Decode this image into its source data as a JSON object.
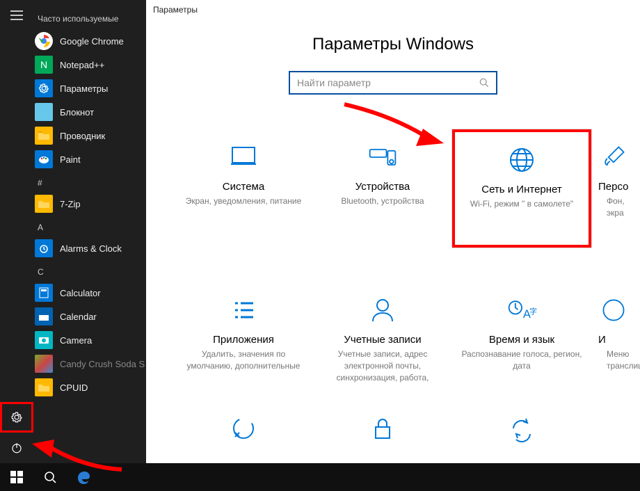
{
  "start_menu": {
    "most_used_header": "Часто используемые",
    "apps": [
      {
        "label": "Google Chrome",
        "color": "#fff"
      },
      {
        "label": "Notepad++",
        "color": "#00a859"
      },
      {
        "label": "Параметры",
        "color": "#0078d7"
      },
      {
        "label": "Блокнот",
        "color": "#67c7eb"
      },
      {
        "label": "Проводник",
        "color": "#ffb900"
      },
      {
        "label": "Paint",
        "color": "#0078d7"
      }
    ],
    "letter_hash": "#",
    "group_hash": [
      {
        "label": "7-Zip",
        "color": "#ffb900"
      }
    ],
    "letter_a": "A",
    "group_a": [
      {
        "label": "Alarms & Clock",
        "color": "#0078d7"
      }
    ],
    "letter_c": "C",
    "group_c": [
      {
        "label": "Calculator",
        "color": "#0078d7"
      },
      {
        "label": "Calendar",
        "color": "#0063b1"
      },
      {
        "label": "Camera",
        "color": "#00b7c3"
      },
      {
        "label": "Candy Crush Soda S",
        "color": "#4a2a00",
        "dim": true
      },
      {
        "label": "CPUID",
        "color": "#ffb900"
      }
    ]
  },
  "settings": {
    "window_title": "Параметры",
    "page_title": "Параметры Windows",
    "search_placeholder": "Найти параметр",
    "tiles": [
      {
        "title": "Система",
        "sub": "Экран, уведомления, питание"
      },
      {
        "title": "Устройства",
        "sub": "Bluetooth, устройства"
      },
      {
        "title": "Сеть и Интернет",
        "sub": "Wi-Fi, режим \" в самолете\""
      },
      {
        "title": "Персо",
        "sub": "Фон, экра"
      },
      {
        "title": "Приложения",
        "sub": "Удалить, значения по умолчанию, дополнительные"
      },
      {
        "title": "Учетные записи",
        "sub": "Учетные записи, адрес электронной почты, синхронизация, работа,"
      },
      {
        "title": "Время и язык",
        "sub": "Распознавание голоса, регион, дата"
      },
      {
        "title": "И",
        "sub": "Меню транслиц"
      }
    ]
  }
}
